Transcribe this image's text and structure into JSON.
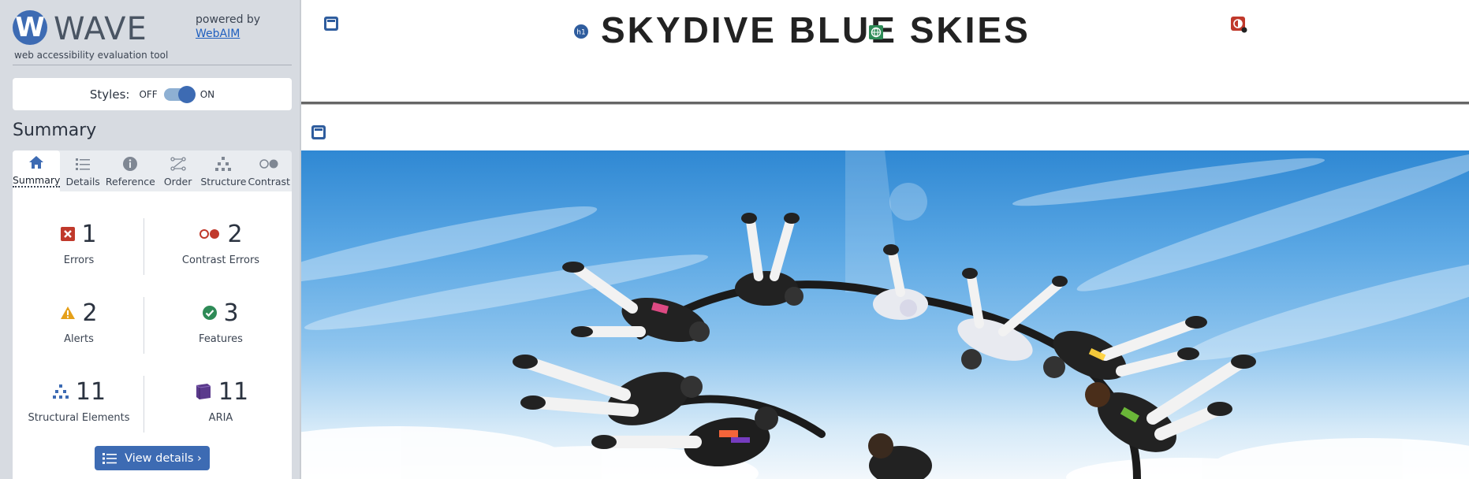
{
  "wave": {
    "logo_letter": "W",
    "logo_word": "WAVE",
    "subtitle": "web accessibility evaluation tool",
    "powered_by": "powered by",
    "webaim_link": "WebAIM",
    "styles_label": "Styles:",
    "styles_off": "OFF",
    "styles_on": "ON",
    "summary_title": "Summary",
    "tabs": [
      {
        "label": "Summary",
        "icon": "home-icon",
        "active": true
      },
      {
        "label": "Details",
        "icon": "list-icon",
        "active": false
      },
      {
        "label": "Reference",
        "icon": "info-icon",
        "active": false
      },
      {
        "label": "Order",
        "icon": "order-icon",
        "active": false
      },
      {
        "label": "Structure",
        "icon": "structure-icon",
        "active": false
      },
      {
        "label": "Contrast",
        "icon": "contrast-icon",
        "active": false
      }
    ],
    "stats": {
      "errors": {
        "count": "1",
        "label": "Errors",
        "color": "#c0392b"
      },
      "contrast_errors": {
        "count": "2",
        "label": "Contrast Errors",
        "color": "#c0392b"
      },
      "alerts": {
        "count": "2",
        "label": "Alerts",
        "color": "#e5a01a"
      },
      "features": {
        "count": "3",
        "label": "Features",
        "color": "#2e8b57"
      },
      "structural": {
        "count": "11",
        "label": "Structural Elements",
        "color": "#3d6bb3"
      },
      "aria": {
        "count": "11",
        "label": "ARIA",
        "color": "#5b3a8c"
      }
    },
    "view_details": "View details ›"
  },
  "page": {
    "site_title": "SKYDIVE BLUE SKIES",
    "h1_badge": "h1",
    "hero_image": "skydivers-formation-photo"
  }
}
